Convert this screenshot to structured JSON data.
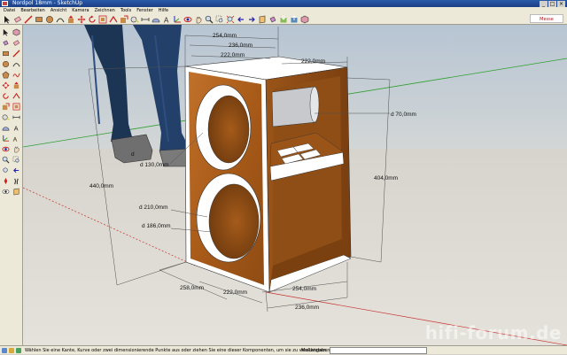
{
  "window": {
    "title": "Nordpol 18mm - SketchUp",
    "controls": [
      "_",
      "□",
      "×"
    ]
  },
  "menu": [
    "Datei",
    "Bearbeiten",
    "Ansicht",
    "Kamera",
    "Zeichnen",
    "Tools",
    "Fenster",
    "Hilfe"
  ],
  "toolbar": {
    "icons": [
      "select-icon",
      "eraser-icon",
      "line-icon",
      "rectangle-icon",
      "circle-icon",
      "arc-icon",
      "push-pull-icon",
      "move-icon",
      "rotate-icon",
      "offset-icon",
      "follow-me-icon",
      "scale-icon",
      "tape-measure-icon",
      "dimension-icon",
      "protractor-icon",
      "text-icon",
      "axes-icon",
      "orbit-icon",
      "pan-icon",
      "zoom-icon",
      "zoom-window-icon",
      "zoom-extents-icon",
      "previous-view-icon",
      "next-view-icon",
      "section-plane-icon",
      "paint-icon",
      "get-models-icon",
      "share-model-icon",
      "components-icon"
    ],
    "brand_label": "Messe",
    "accent": "#b01818"
  },
  "model": {
    "colors": {
      "wood": "#b5651d",
      "wood_dark": "#7e4310",
      "edge": "#ffffff",
      "dim_line": "#505050",
      "axis_green": "#2ea02e",
      "axis_red": "#c83232",
      "sky": "#bcc9d6",
      "ground": "#dfdcd4"
    },
    "dimensions": {
      "top_outer": "254,0mm",
      "top_inner": "236,0mm",
      "top_depth": "222,0mm",
      "top_right": "222,0mm",
      "port_diameter": "d 70,0mm",
      "height_left": "440,0mm",
      "height_right": "404,0mm",
      "tweeter_outer": "d 130,0mm",
      "woofer_outer": "d 210,0mm",
      "woofer_inner": "d 186,0mm",
      "bottom_left": "258,0mm",
      "bottom_front": "222,0mm",
      "bottom_right_outer": "254,0mm",
      "bottom_right_inner": "236,0mm",
      "tweeter_inner": "d"
    }
  },
  "status": {
    "text": "Wählen Sie eine Kante, Kurve oder zwei dimensionierende Punkte aus oder ziehen Sie eine dieser Komponenten, um sie zu verschieben.",
    "measure_label": "Maßangaben",
    "measure_value": ""
  },
  "watermark": "hifi-forum.de"
}
